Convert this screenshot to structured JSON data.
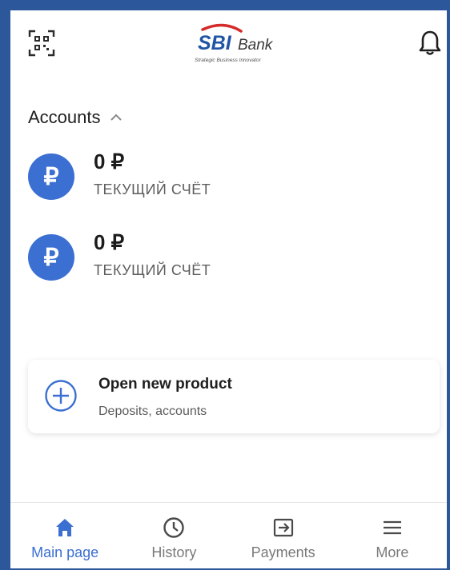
{
  "header": {
    "logo_brand": "SBI",
    "logo_word": "Bank",
    "logo_tagline": "Strategic Business Innovator"
  },
  "accounts": {
    "title": "Accounts",
    "items": [
      {
        "amount": "0 ₽",
        "type": "ТЕКУЩИЙ СЧЁТ",
        "currency_symbol": "₽"
      },
      {
        "amount": "0 ₽",
        "type": "ТЕКУЩИЙ СЧЁТ",
        "currency_symbol": "₽"
      }
    ]
  },
  "product_card": {
    "title": "Open new product",
    "subtitle": "Deposits, accounts"
  },
  "nav": {
    "items": [
      {
        "label": "Main page",
        "icon": "home-icon",
        "active": true
      },
      {
        "label": "History",
        "icon": "clock-icon",
        "active": false
      },
      {
        "label": "Payments",
        "icon": "transfer-icon",
        "active": false
      },
      {
        "label": "More",
        "icon": "menu-icon",
        "active": false
      }
    ]
  },
  "colors": {
    "accent": "#3b6fd2",
    "frame": "#2d579b",
    "logo_red": "#d42b2b",
    "logo_blue": "#1f55a5"
  }
}
